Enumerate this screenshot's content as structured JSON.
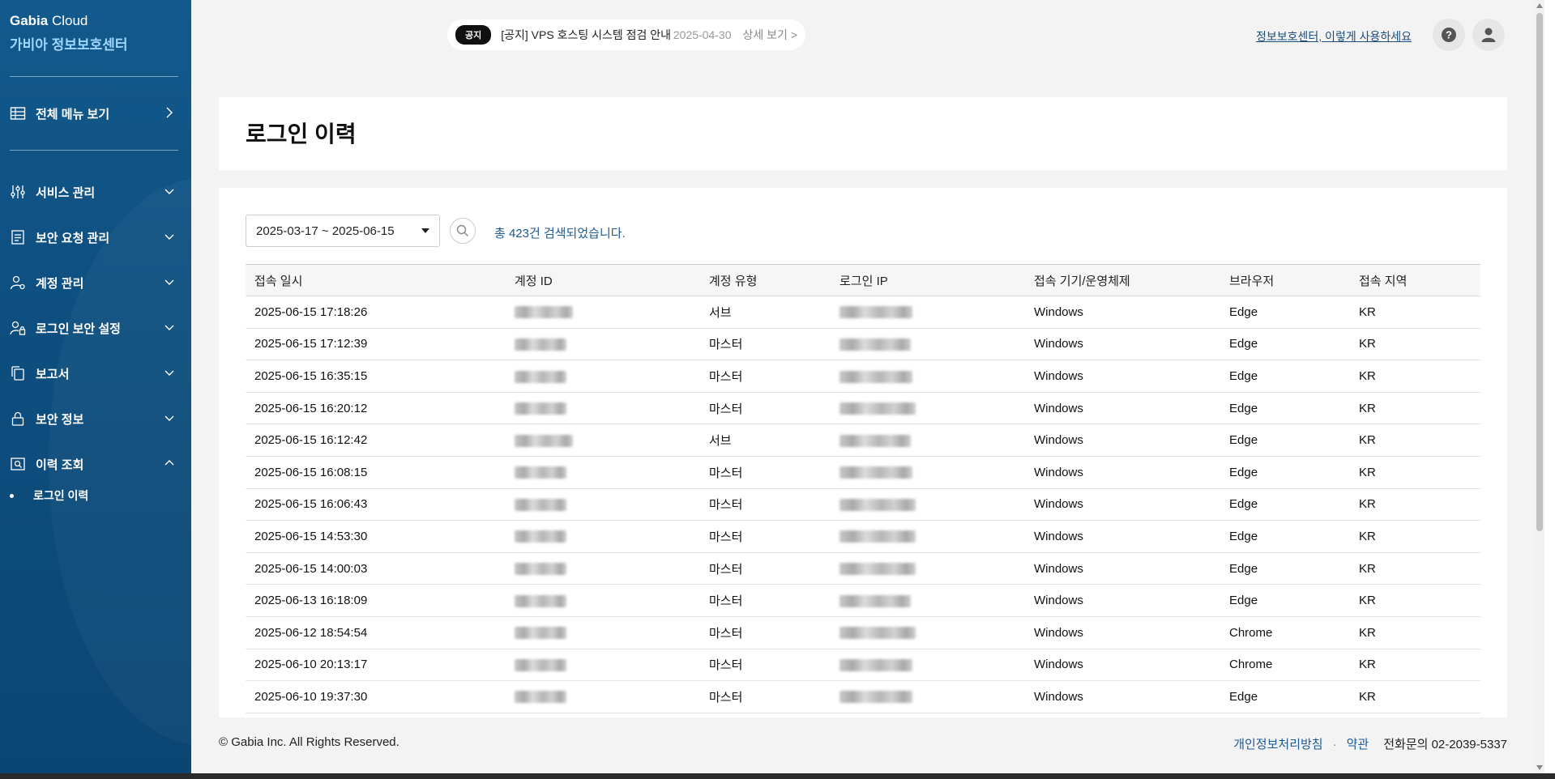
{
  "brand": {
    "line1_bold": "Gabia",
    "line1_rest": " Cloud",
    "line2": "가비아 정보보호센터"
  },
  "sidebar": {
    "all_menu": "전체 메뉴 보기",
    "items": [
      {
        "label": "서비스 관리",
        "icon": "sliders-icon"
      },
      {
        "label": "보안 요청 관리",
        "icon": "document-icon"
      },
      {
        "label": "계정 관리",
        "icon": "user-settings-icon"
      },
      {
        "label": "로그인 보안 설정",
        "icon": "user-lock-icon"
      },
      {
        "label": "보고서",
        "icon": "copy-icon"
      },
      {
        "label": "보안 정보",
        "icon": "lock-icon"
      },
      {
        "label": "이력 조회",
        "icon": "history-search-icon"
      }
    ],
    "sub_item": "로그인 이력"
  },
  "notice": {
    "tag": "공지",
    "title": "[공지] VPS 호스팅 시스템 점검 안내",
    "date": "2025-04-30",
    "more": "상세 보기 >"
  },
  "header": {
    "guide_link": "정보보호센터, 이렇게 사용하세요",
    "help": "?"
  },
  "page": {
    "title": "로그인 이력"
  },
  "filter": {
    "date_range": "2025-03-17 ~ 2025-06-15",
    "result_text": "총 423건 검색되었습니다."
  },
  "table": {
    "columns": [
      "접속 일시",
      "계정 ID",
      "계정 유형",
      "로그인 IP",
      "접속 기기/운영체제",
      "브라우저",
      "접속 지역"
    ],
    "rows": [
      {
        "datetime": "2025-06-15 17:18:26",
        "type": "서브",
        "os": "Windows",
        "browser": "Edge",
        "region": "KR"
      },
      {
        "datetime": "2025-06-15 17:12:39",
        "type": "마스터",
        "os": "Windows",
        "browser": "Edge",
        "region": "KR"
      },
      {
        "datetime": "2025-06-15 16:35:15",
        "type": "마스터",
        "os": "Windows",
        "browser": "Edge",
        "region": "KR"
      },
      {
        "datetime": "2025-06-15 16:20:12",
        "type": "마스터",
        "os": "Windows",
        "browser": "Edge",
        "region": "KR"
      },
      {
        "datetime": "2025-06-15 16:12:42",
        "type": "서브",
        "os": "Windows",
        "browser": "Edge",
        "region": "KR"
      },
      {
        "datetime": "2025-06-15 16:08:15",
        "type": "마스터",
        "os": "Windows",
        "browser": "Edge",
        "region": "KR"
      },
      {
        "datetime": "2025-06-15 16:06:43",
        "type": "마스터",
        "os": "Windows",
        "browser": "Edge",
        "region": "KR"
      },
      {
        "datetime": "2025-06-15 14:53:30",
        "type": "마스터",
        "os": "Windows",
        "browser": "Edge",
        "region": "KR"
      },
      {
        "datetime": "2025-06-15 14:00:03",
        "type": "마스터",
        "os": "Windows",
        "browser": "Edge",
        "region": "KR"
      },
      {
        "datetime": "2025-06-13 16:18:09",
        "type": "마스터",
        "os": "Windows",
        "browser": "Edge",
        "region": "KR"
      },
      {
        "datetime": "2025-06-12 18:54:54",
        "type": "마스터",
        "os": "Windows",
        "browser": "Chrome",
        "region": "KR"
      },
      {
        "datetime": "2025-06-10 20:13:17",
        "type": "마스터",
        "os": "Windows",
        "browser": "Chrome",
        "region": "KR"
      },
      {
        "datetime": "2025-06-10 19:37:30",
        "type": "마스터",
        "os": "Windows",
        "browser": "Edge",
        "region": "KR"
      }
    ]
  },
  "footer": {
    "copyright": "© Gabia Inc. All Rights Reserved.",
    "privacy": "개인정보처리방침",
    "dot": "·",
    "terms": "약관",
    "tel": "전화문의 02-2039-5337"
  },
  "colors": {
    "sidebar": "#135a8c",
    "brand_sub": "#9fd6ff",
    "link": "#1b5a96"
  }
}
